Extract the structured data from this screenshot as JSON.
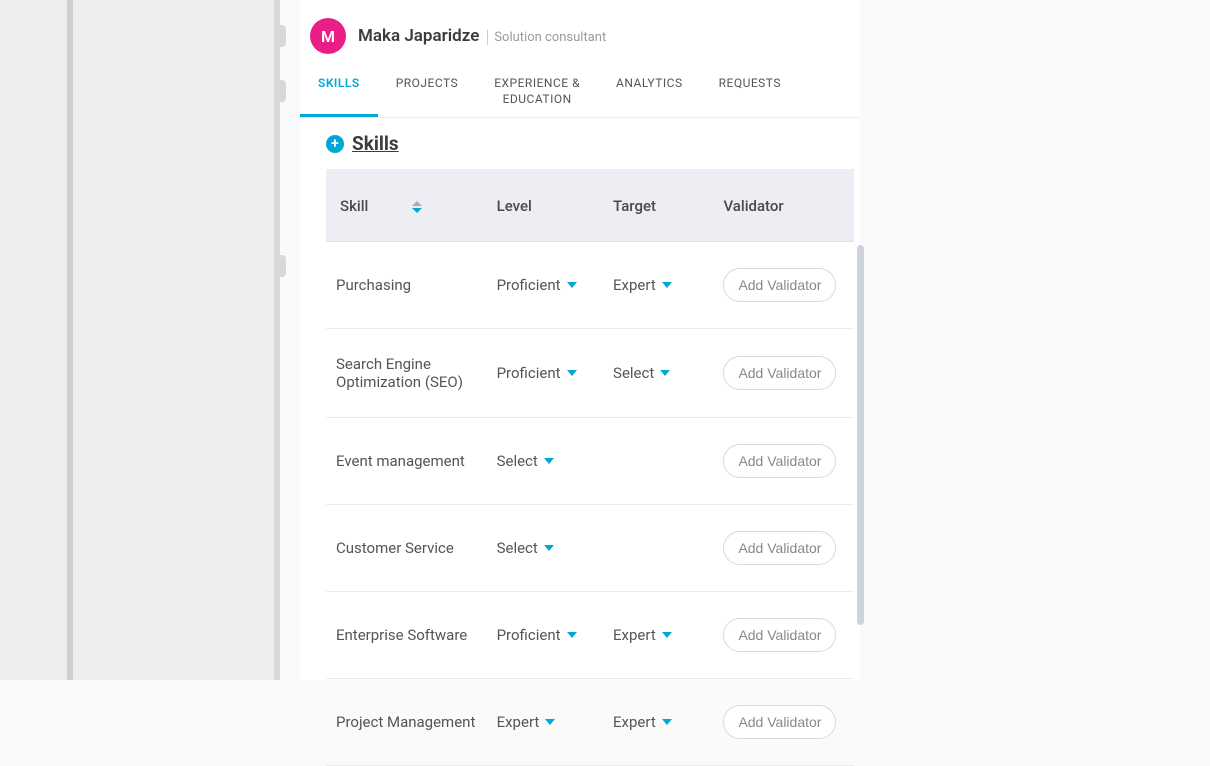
{
  "profile": {
    "avatar_initial": "M",
    "name": "Maka Japaridze",
    "role": "Solution consultant"
  },
  "tabs": [
    {
      "label": "SKILLS",
      "active": true
    },
    {
      "label": "PROJECTS",
      "active": false
    },
    {
      "label": "EXPERIENCE &\nEDUCATION",
      "active": false
    },
    {
      "label": "ANALYTICS",
      "active": false
    },
    {
      "label": "REQUESTS",
      "active": false
    }
  ],
  "section": {
    "title": "Skills"
  },
  "table": {
    "headers": {
      "skill": "Skill",
      "level": "Level",
      "target": "Target",
      "validator": "Validator"
    },
    "add_validator_label": "Add Validator",
    "rows": [
      {
        "skill": "Purchasing",
        "level": "Proficient",
        "target": "Expert"
      },
      {
        "skill": "Search Engine Optimization (SEO)",
        "level": "Proficient",
        "target": "Select"
      },
      {
        "skill": "Event management",
        "level": "Select",
        "target": ""
      },
      {
        "skill": "Customer Service",
        "level": "Select",
        "target": ""
      },
      {
        "skill": "Enterprise Software",
        "level": "Proficient",
        "target": "Expert"
      },
      {
        "skill": "Project Management",
        "level": "Expert",
        "target": "Expert"
      }
    ]
  }
}
